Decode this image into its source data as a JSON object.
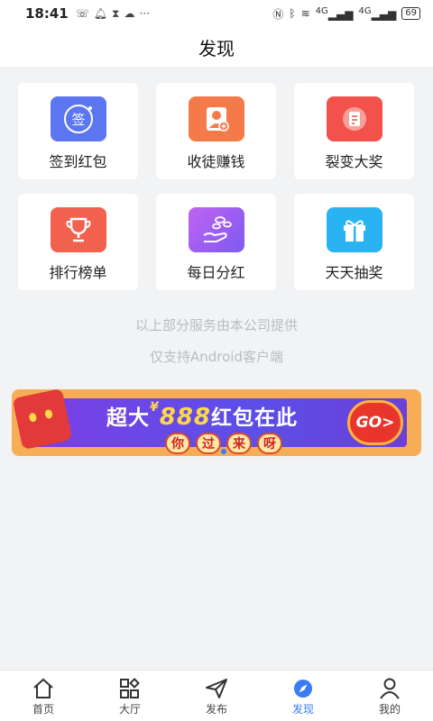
{
  "status_bar": {
    "time": "18:41",
    "battery": "69",
    "network_1": "4G",
    "network_2": "4G"
  },
  "header": {
    "title": "发现"
  },
  "grid": {
    "items": [
      {
        "label": "签到红包",
        "icon": "sign-in-icon",
        "color": "#5b76f0"
      },
      {
        "label": "收徒赚钱",
        "icon": "recruit-icon",
        "color": "#f57a4a"
      },
      {
        "label": "裂变大奖",
        "icon": "note-icon",
        "color": "#f2524b"
      },
      {
        "label": "排行榜单",
        "icon": "trophy-icon",
        "color": "#f2604e"
      },
      {
        "label": "每日分红",
        "icon": "dividend-icon",
        "color": "#a057f0"
      },
      {
        "label": "天天抽奖",
        "icon": "gift-icon",
        "color": "#2ab3f2"
      }
    ]
  },
  "notes": {
    "line1": "以上部分服务由本公司提供",
    "line2": "仅支持Android客户端"
  },
  "banner": {
    "title_a": "超大",
    "currency": "¥",
    "amount": "888",
    "title_b": "红包在此",
    "sub": [
      "你",
      "过",
      "来",
      "呀"
    ],
    "go": "GO>",
    "badge_char": "¥"
  },
  "bottom_nav": {
    "items": [
      {
        "label": "首页",
        "icon": "home-icon"
      },
      {
        "label": "大厅",
        "icon": "grid-icon"
      },
      {
        "label": "发布",
        "icon": "send-icon"
      },
      {
        "label": "发现",
        "icon": "compass-icon",
        "active": true
      },
      {
        "label": "我的",
        "icon": "user-icon"
      }
    ],
    "active_color": "#3a7cf6"
  }
}
